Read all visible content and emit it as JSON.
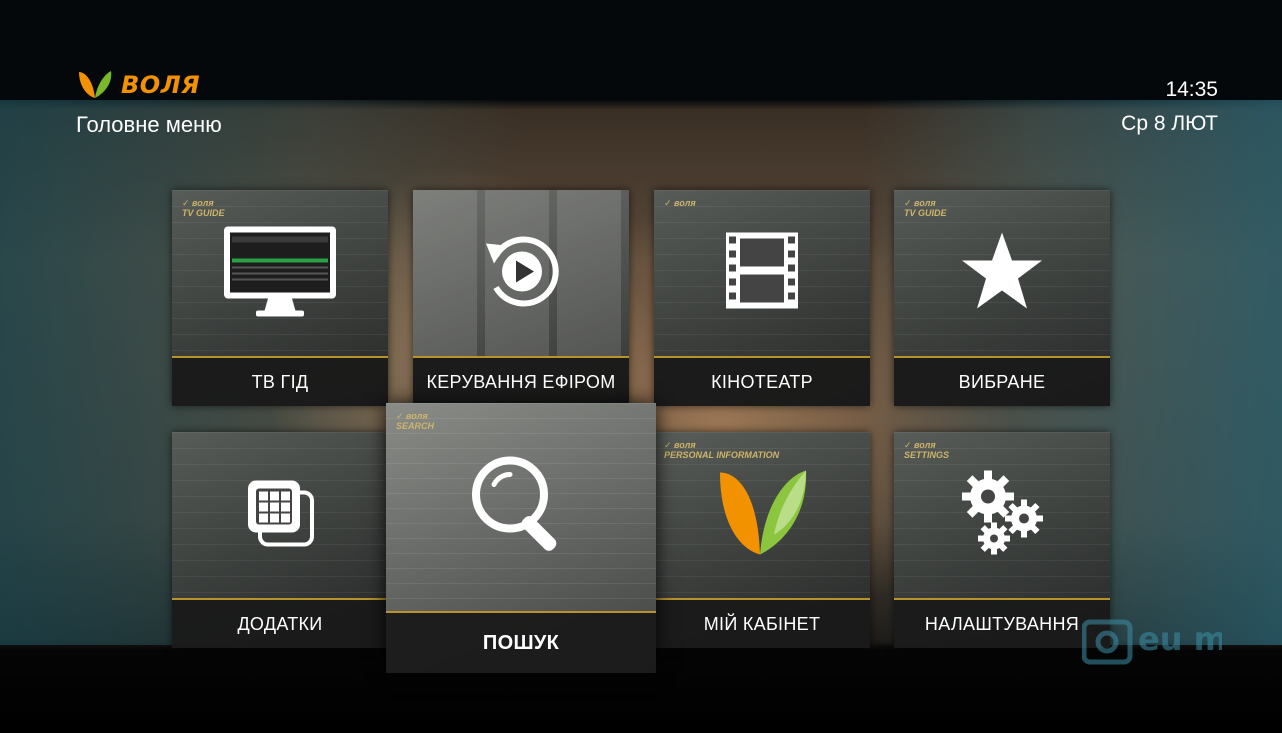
{
  "brand": {
    "name": "ВОЛЯ",
    "accent": "#f39200",
    "green": "#78b82a"
  },
  "header": {
    "screen_title": "Головне меню",
    "time": "14:35",
    "date": "Ср 8 ЛЮТ"
  },
  "menu": {
    "tiles": [
      {
        "label": "ТВ ГІД",
        "icon": "tv-monitor-icon"
      },
      {
        "label": "КЕРУВАННЯ ЕФІРОМ",
        "icon": "replay-play-icon"
      },
      {
        "label": "КІНОТЕАТР",
        "icon": "film-strip-icon"
      },
      {
        "label": "ВИБРАНЕ",
        "icon": "star-icon"
      },
      {
        "label": "ДОДАТКИ",
        "icon": "app-grid-icon"
      },
      {
        "label": "ПОШУК",
        "icon": "magnifier-icon",
        "focused": true
      },
      {
        "label": "МІЙ КАБІНЕТ",
        "icon": "volia-leaf-icon"
      },
      {
        "label": "НАЛАШТУВАННЯ",
        "icon": "gears-icon"
      }
    ]
  },
  "channel_watermark": {
    "text": "eu music"
  }
}
